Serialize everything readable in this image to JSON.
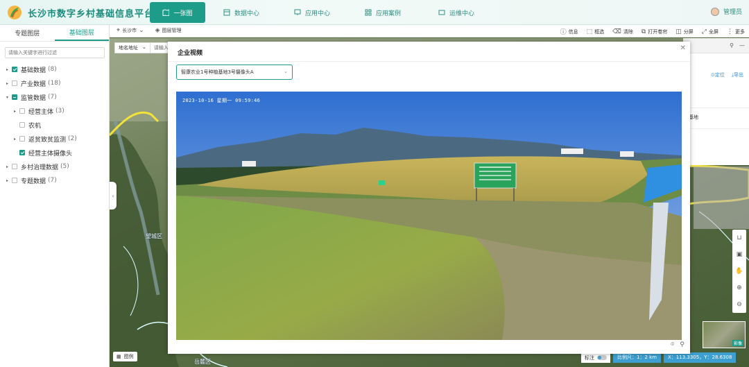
{
  "app": {
    "title": "长沙市数字乡村基础信息平台"
  },
  "nav": {
    "items": [
      {
        "label": "一张图",
        "icon": "map-icon",
        "active": true
      },
      {
        "label": "数据中心",
        "icon": "data-icon",
        "active": false
      },
      {
        "label": "应用中心",
        "icon": "monitor-icon",
        "active": false
      },
      {
        "label": "应用案例",
        "icon": "grid-icon",
        "active": false
      },
      {
        "label": "运维中心",
        "icon": "screen-icon",
        "active": false
      }
    ]
  },
  "user": {
    "name": "管理员"
  },
  "left_panel": {
    "tabs": [
      "专题图层",
      "基础图层"
    ],
    "active_tab": "基础图层",
    "search_placeholder": "请输入关键字进行过滤",
    "tree": [
      {
        "label": "基础数据",
        "count": "(8)",
        "checked": "on",
        "caret": "▸",
        "indent": 0
      },
      {
        "label": "产业数据",
        "count": "(18)",
        "checked": "off",
        "caret": "▸",
        "indent": 0
      },
      {
        "label": "监管数据",
        "count": "(7)",
        "checked": "half",
        "caret": "▾",
        "indent": 0
      },
      {
        "label": "经营主体",
        "count": "(3)",
        "checked": "off",
        "caret": "▸",
        "indent": 1
      },
      {
        "label": "农机",
        "count": "",
        "checked": "off",
        "caret": "",
        "indent": 1
      },
      {
        "label": "返贫致贫监测",
        "count": "(2)",
        "checked": "off",
        "caret": "▸",
        "indent": 1
      },
      {
        "label": "经营主体摄像头",
        "count": "",
        "checked": "on",
        "caret": "",
        "indent": 1
      },
      {
        "label": "乡村治理数据",
        "count": "(5)",
        "checked": "off",
        "caret": "▸",
        "indent": 0
      },
      {
        "label": "专题数据",
        "count": "(7)",
        "checked": "off",
        "caret": "▸",
        "indent": 0
      }
    ]
  },
  "toolbar": {
    "city": "长沙市",
    "layer_mgmt": "图层管理",
    "tools": [
      "信息",
      "框选",
      "清除",
      "打开卷帘",
      "分屏",
      "全屏",
      "更多"
    ]
  },
  "map": {
    "address_select": "地名地址",
    "address_placeholder": "请输入",
    "place_label_1": "望城区",
    "place_label_2": "岳麓区",
    "right_panel": {
      "locate": "定位",
      "export": "导出",
      "row_text": "基地"
    },
    "legend": "图例",
    "label_toggle": "标注",
    "scale": "比例尺：1：2 km",
    "coords": "X：113.3305，Y：28.6308",
    "minimap_label": "影像"
  },
  "modal": {
    "title": "企业视频",
    "camera_selected": "智康农业1号种植基地3号摄像头A",
    "timestamp": "2023-10-16 星期一 09:59:46"
  }
}
